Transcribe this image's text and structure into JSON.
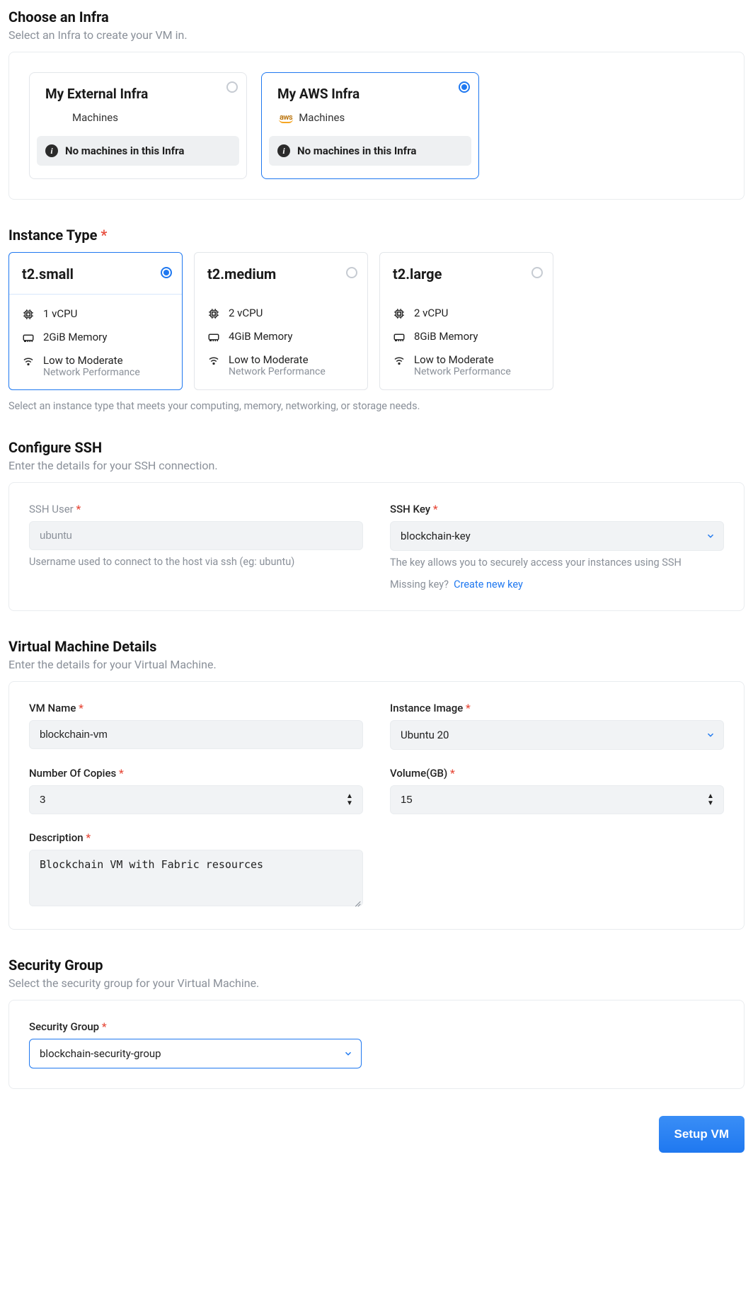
{
  "infra": {
    "title": "Choose an Infra",
    "subtitle": "Select an Infra to create your VM in.",
    "cards": [
      {
        "title": "My External Infra",
        "machines_label": "Machines",
        "aws": false,
        "msg": "No machines in this Infra",
        "selected": false
      },
      {
        "title": "My AWS Infra",
        "machines_label": "Machines",
        "aws": true,
        "aws_badge": "aws",
        "msg": "No machines in this Infra",
        "selected": true
      }
    ]
  },
  "itype": {
    "title": "Instance Type",
    "cards": [
      {
        "name": "t2.small",
        "cpu": "1 vCPU",
        "mem": "2GiB Memory",
        "net": "Low to Moderate",
        "net_sub": "Network Performance",
        "selected": true
      },
      {
        "name": "t2.medium",
        "cpu": "2 vCPU",
        "mem": "4GiB Memory",
        "net": "Low to Moderate",
        "net_sub": "Network Performance",
        "selected": false
      },
      {
        "name": "t2.large",
        "cpu": "2 vCPU",
        "mem": "8GiB Memory",
        "net": "Low to Moderate",
        "net_sub": "Network Performance",
        "selected": false
      }
    ],
    "helper": "Select an instance type that meets your computing, memory, networking, or storage needs."
  },
  "ssh": {
    "title": "Configure SSH",
    "subtitle": "Enter the details for your SSH connection.",
    "user_label": "SSH User",
    "user_value": "ubuntu",
    "user_help": "Username used to connect to the host via ssh (eg: ubuntu)",
    "key_label": "SSH Key",
    "key_value": "blockchain-key",
    "key_help": "The key allows you to securely access your instances using SSH",
    "missing_prefix": "Missing key?",
    "missing_link": "Create new key"
  },
  "vm": {
    "title": "Virtual Machine Details",
    "subtitle": "Enter the details for your Virtual Machine.",
    "name_label": "VM Name",
    "name_value": "blockchain-vm",
    "image_label": "Instance Image",
    "image_value": "Ubuntu 20",
    "copies_label": "Number Of Copies",
    "copies_value": "3",
    "volume_label": "Volume(GB)",
    "volume_value": "15",
    "desc_label": "Description",
    "desc_value": "Blockchain VM with Fabric resources"
  },
  "sg": {
    "title": "Security Group",
    "subtitle": "Select the security group for your Virtual Machine.",
    "label": "Security Group",
    "value": "blockchain-security-group"
  },
  "submit_label": "Setup VM"
}
